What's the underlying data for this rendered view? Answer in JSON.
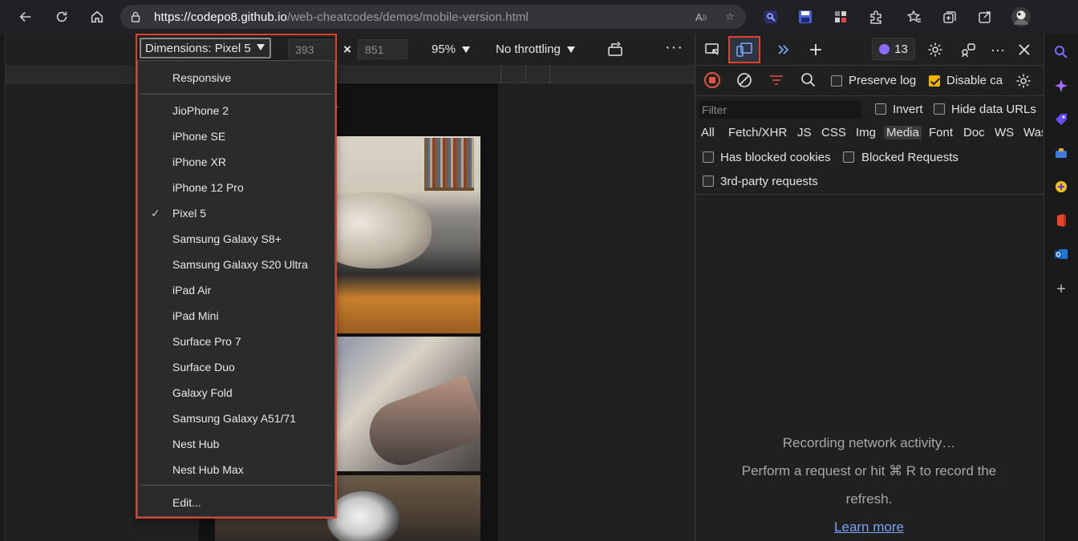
{
  "browser": {
    "url_host": "https://codepo8.github.io",
    "url_path": "/web-cheatcodes/demos/mobile-version.html"
  },
  "device_toolbar": {
    "dimensions_label": "Dimensions: Pixel 5",
    "width": "393",
    "height": "851",
    "times": "×",
    "zoom": "95%",
    "throttling": "No throttling",
    "more": "···"
  },
  "dropdown": {
    "check": "✓",
    "items": [
      "Responsive",
      "JioPhone 2",
      "iPhone SE",
      "iPhone XR",
      "iPhone 12 Pro",
      "Pixel 5",
      "Samsung Galaxy S8+",
      "Samsung Galaxy S20 Ultra",
      "iPad Air",
      "iPad Mini",
      "Surface Pro 7",
      "Surface Duo",
      "Galaxy Fold",
      "Samsung Galaxy A51/71",
      "Nest Hub",
      "Nest Hub Max",
      "Edit..."
    ],
    "selected": "Pixel 5"
  },
  "devtools": {
    "issues_count": "13",
    "preserve_log": "Preserve log",
    "disable_cache": "Disable ca",
    "filter_placeholder": "Filter",
    "invert": "Invert",
    "hide_data_urls": "Hide data URLs",
    "types": [
      "All",
      "Fetch/XHR",
      "JS",
      "CSS",
      "Img",
      "Media",
      "Font",
      "Doc",
      "WS",
      "Was"
    ],
    "active_type": "Media",
    "has_blocked_cookies": "Has blocked cookies",
    "blocked_requests": "Blocked Requests",
    "third_party": "3rd-party requests",
    "empty_line1": "Recording network activity…",
    "empty_line2": "Perform a request or hit ⌘ R to record the",
    "empty_line3": "refresh.",
    "learn_more": "Learn more"
  },
  "colors": {
    "accent_red": "#e0402c",
    "link_blue": "#7aa2f7",
    "checkbox_yellow": "#f2b400"
  }
}
